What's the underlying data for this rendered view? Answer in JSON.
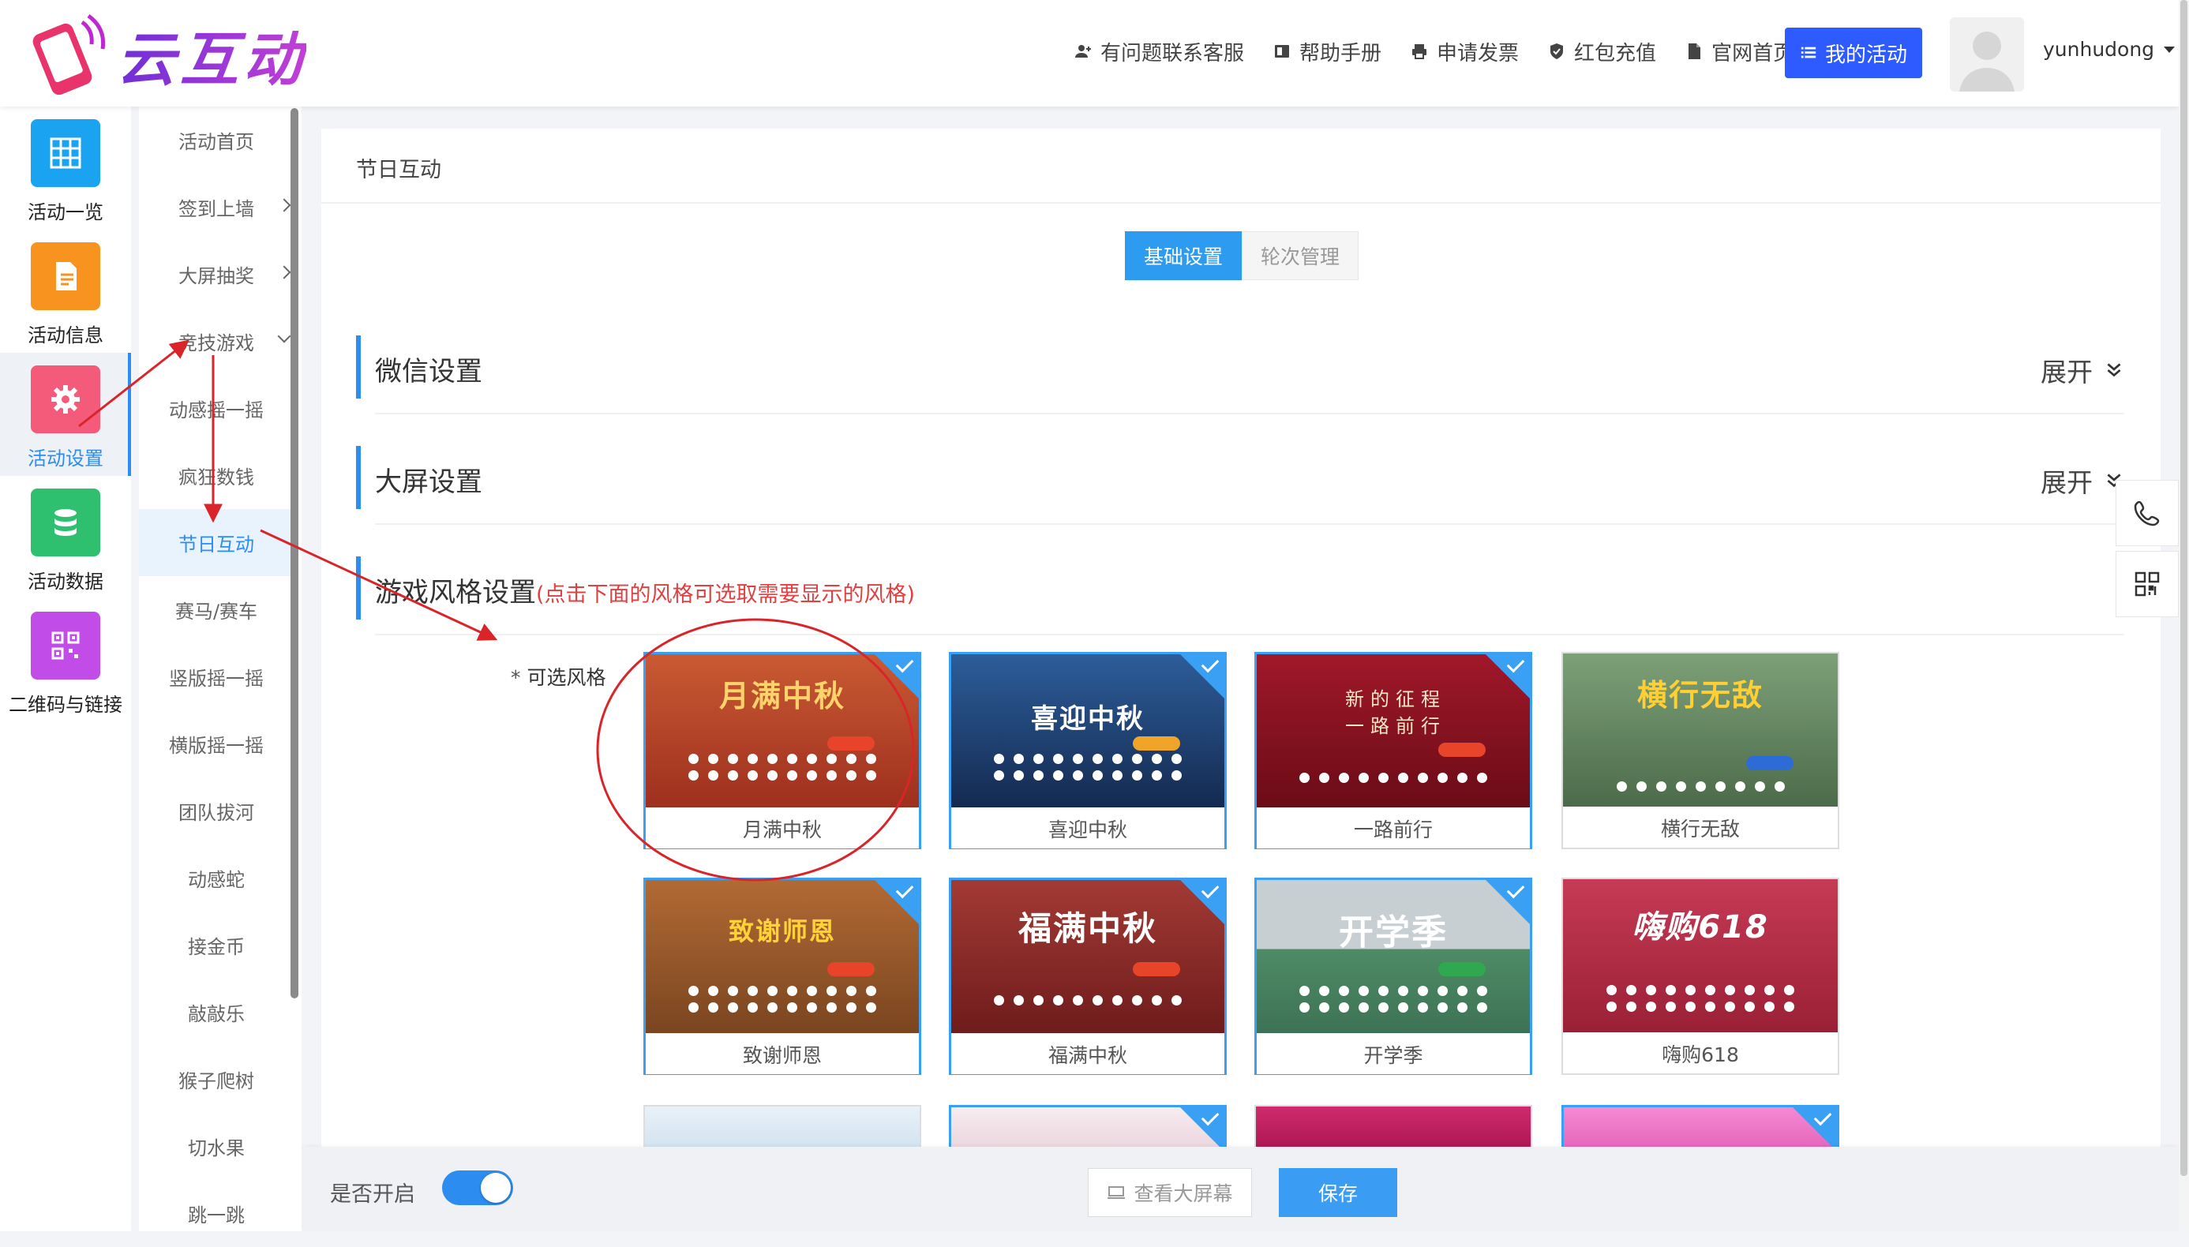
{
  "header": {
    "logo_text": "云互动",
    "nav": [
      {
        "label": "有问题联系客服",
        "icon": "user-add-icon"
      },
      {
        "label": "帮助手册",
        "icon": "book-icon"
      },
      {
        "label": "申请发票",
        "icon": "printer-icon"
      },
      {
        "label": "红包充值",
        "icon": "shield-check-icon"
      },
      {
        "label": "官网首页",
        "icon": "file-icon"
      }
    ],
    "my_activity": "我的活动",
    "username": "yunhudong"
  },
  "sidebar": {
    "items": [
      {
        "label": "活动一览",
        "icon": "grid-icon",
        "color": "#1aa3f0"
      },
      {
        "label": "活动信息",
        "icon": "document-icon",
        "color": "#f7931e"
      },
      {
        "label": "活动设置",
        "icon": "gear-icon",
        "color": "#f45a7a"
      },
      {
        "label": "活动数据",
        "icon": "database-icon",
        "color": "#2fc06f"
      },
      {
        "label": "二维码与链接",
        "icon": "qrcode-icon",
        "color": "#c24ce8"
      }
    ]
  },
  "subnav": {
    "items": [
      {
        "label": "活动首页"
      },
      {
        "label": "签到上墙"
      },
      {
        "label": "大屏抽奖"
      },
      {
        "label": "竞技游戏"
      },
      {
        "label": "动感摇一摇"
      },
      {
        "label": "疯狂数钱"
      },
      {
        "label": "节日互动"
      },
      {
        "label": "赛马/赛车"
      },
      {
        "label": "竖版摇一摇"
      },
      {
        "label": "横版摇一摇"
      },
      {
        "label": "团队拔河"
      },
      {
        "label": "动感蛇"
      },
      {
        "label": "接金币"
      },
      {
        "label": "敲敲乐"
      },
      {
        "label": "猴子爬树"
      },
      {
        "label": "切水果"
      },
      {
        "label": "跳一跳"
      }
    ]
  },
  "main": {
    "breadcrumb": "节日互动",
    "tabs": [
      "基础设置",
      "轮次管理"
    ],
    "sections": {
      "wechat": "微信设置",
      "screen": "大屏设置",
      "style": "游戏风格设置",
      "style_note": "(点击下面的风格可选取需要显示的风格)",
      "expand": "展开"
    },
    "option_label": "可选风格",
    "option_star": "*",
    "themes": [
      {
        "name": "月满中秋",
        "title": "月满中秋",
        "bg": "#b8442a"
      },
      {
        "name": "喜迎中秋",
        "title": "喜迎中秋",
        "bg": "#1f3f73"
      },
      {
        "name": "一路前行",
        "title": "新的征程 一路前行",
        "bg": "#8b1420"
      },
      {
        "name": "横行无敌",
        "title": "横行无敌",
        "bg": "#6f8c6a"
      },
      {
        "name": "致谢师恩",
        "title": "致谢师恩",
        "bg": "#9a5a2c"
      },
      {
        "name": "福满中秋",
        "title": "福满中秋",
        "bg": "#8e2a2a"
      },
      {
        "name": "开学季",
        "title": "开学季",
        "bg": "#5a8f6f"
      },
      {
        "name": "嗨购618",
        "title": "嗨购618",
        "bg": "#b23048"
      }
    ],
    "bottom_themes": [
      {
        "bg": "#dcebf6"
      },
      {
        "bg": "#f1e6ec"
      },
      {
        "bg": "#c9246b"
      },
      {
        "bg": "#f07cc8"
      }
    ]
  },
  "footer": {
    "enable_label": "是否开启",
    "preview": "查看大屏幕",
    "save": "保存"
  }
}
